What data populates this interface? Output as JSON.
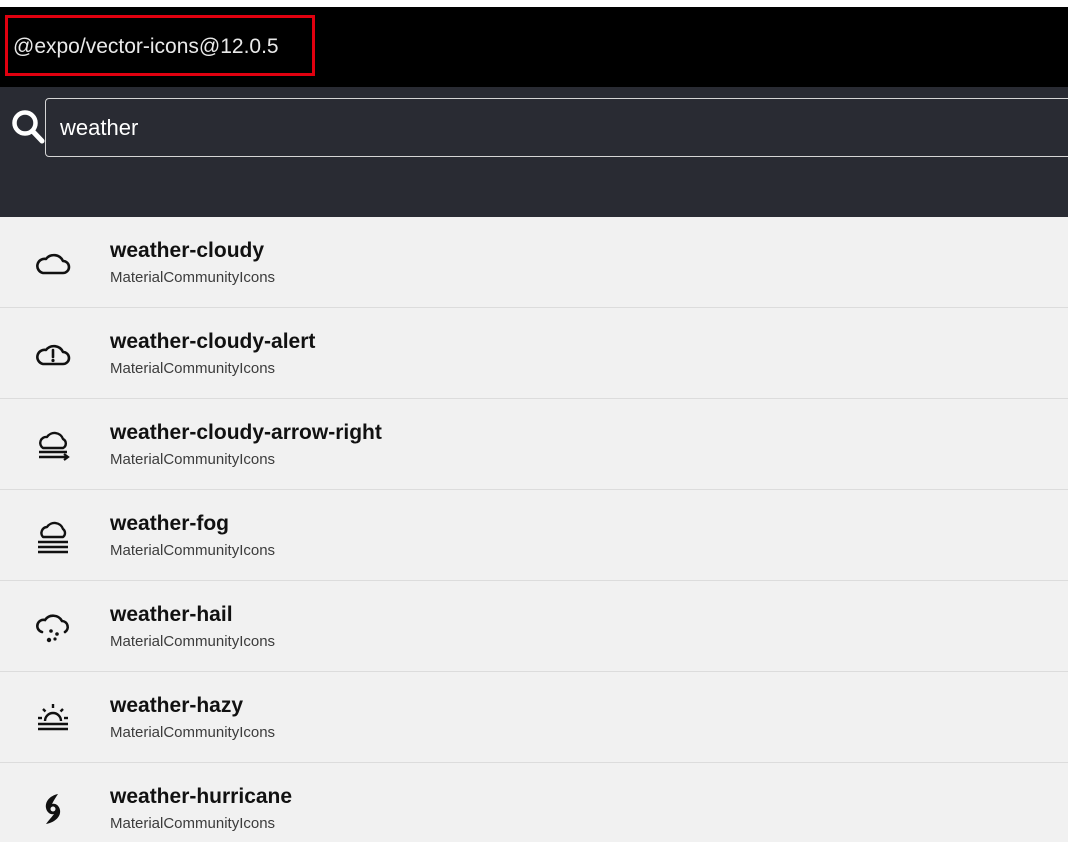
{
  "header": {
    "title": "@expo/vector-icons@12.0.5"
  },
  "search": {
    "value": "weather",
    "icon": "search-icon"
  },
  "results": [
    {
      "name": "weather-cloudy",
      "library": "MaterialCommunityIcons",
      "icon": "weather-cloudy-icon"
    },
    {
      "name": "weather-cloudy-alert",
      "library": "MaterialCommunityIcons",
      "icon": "weather-cloudy-alert-icon"
    },
    {
      "name": "weather-cloudy-arrow-right",
      "library": "MaterialCommunityIcons",
      "icon": "weather-cloudy-arrow-right-icon"
    },
    {
      "name": "weather-fog",
      "library": "MaterialCommunityIcons",
      "icon": "weather-fog-icon"
    },
    {
      "name": "weather-hail",
      "library": "MaterialCommunityIcons",
      "icon": "weather-hail-icon"
    },
    {
      "name": "weather-hazy",
      "library": "MaterialCommunityIcons",
      "icon": "weather-hazy-icon"
    },
    {
      "name": "weather-hurricane",
      "library": "MaterialCommunityIcons",
      "icon": "weather-hurricane-icon"
    }
  ],
  "colors": {
    "header_bg": "#000000",
    "search_bg": "#292b33",
    "results_bg": "#f1f1f1",
    "highlight_border": "#e0000f"
  }
}
